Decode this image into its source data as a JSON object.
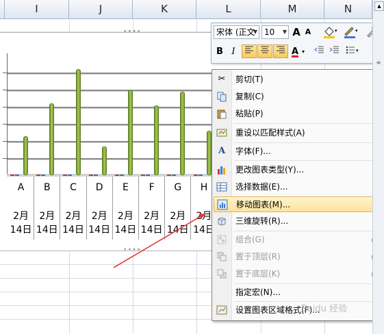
{
  "columns": [
    "I",
    "J",
    "K",
    "L",
    "M",
    "N"
  ],
  "chart_data": {
    "type": "bar",
    "categories": [
      "A",
      "B",
      "C",
      "D",
      "E",
      "F",
      "G",
      "H"
    ],
    "category_dates": [
      "2月\n14日",
      "2月\n14日",
      "2月\n14日",
      "2月\n14日",
      "2月\n14日",
      "2月\n14日",
      "2月\n14日",
      "2月\n14日"
    ],
    "values": [
      2.3,
      4.2,
      6.2,
      1.7,
      5.0,
      4.1,
      4.9,
      2.6
    ],
    "ylim": [
      0,
      6.5
    ],
    "grid": true,
    "bar_color": "#8db33c",
    "title": "",
    "xlabel": "",
    "ylabel": ""
  },
  "mini_toolbar": {
    "font_name": "宋体 (正文",
    "font_size": "10",
    "grow_font": "A",
    "shrink_font": "A",
    "bold": "B",
    "italic": "I",
    "font_color_label": "A",
    "accent_red": "#e02020"
  },
  "context_menu": [
    {
      "label": "剪切(T)",
      "icon": "scissors-icon",
      "enabled": true
    },
    {
      "label": "复制(C)",
      "icon": "copy-icon",
      "enabled": true
    },
    {
      "label": "粘贴(P)",
      "icon": "paste-icon",
      "enabled": true
    },
    {
      "label": "重设以匹配样式(A)",
      "icon": "reset-style-icon",
      "enabled": true
    },
    {
      "label": "字体(F)...",
      "icon": "font-icon",
      "enabled": true
    },
    {
      "label": "更改图表类型(Y)...",
      "icon": "chart-type-icon",
      "enabled": true
    },
    {
      "label": "选择数据(E)...",
      "icon": "select-data-icon",
      "enabled": true
    },
    {
      "label": "移动图表(M)...",
      "icon": "move-chart-icon",
      "enabled": true
    },
    {
      "label": "三维旋转(R)...",
      "icon": "rotate-3d-icon",
      "enabled": true
    },
    {
      "label": "组合(G)",
      "icon": "group-icon",
      "enabled": false
    },
    {
      "label": "置于顶层(R)",
      "icon": "bring-front-icon",
      "enabled": false
    },
    {
      "label": "置于底层(K)",
      "icon": "send-back-icon",
      "enabled": false
    },
    {
      "label": "指定宏(N)...",
      "icon": "",
      "enabled": true
    },
    {
      "label": "设置图表区域格式(F)...",
      "icon": "format-chart-area-icon",
      "enabled": true
    }
  ],
  "watermark": "Baidu 经验",
  "arrow_color": "#e23a3a"
}
